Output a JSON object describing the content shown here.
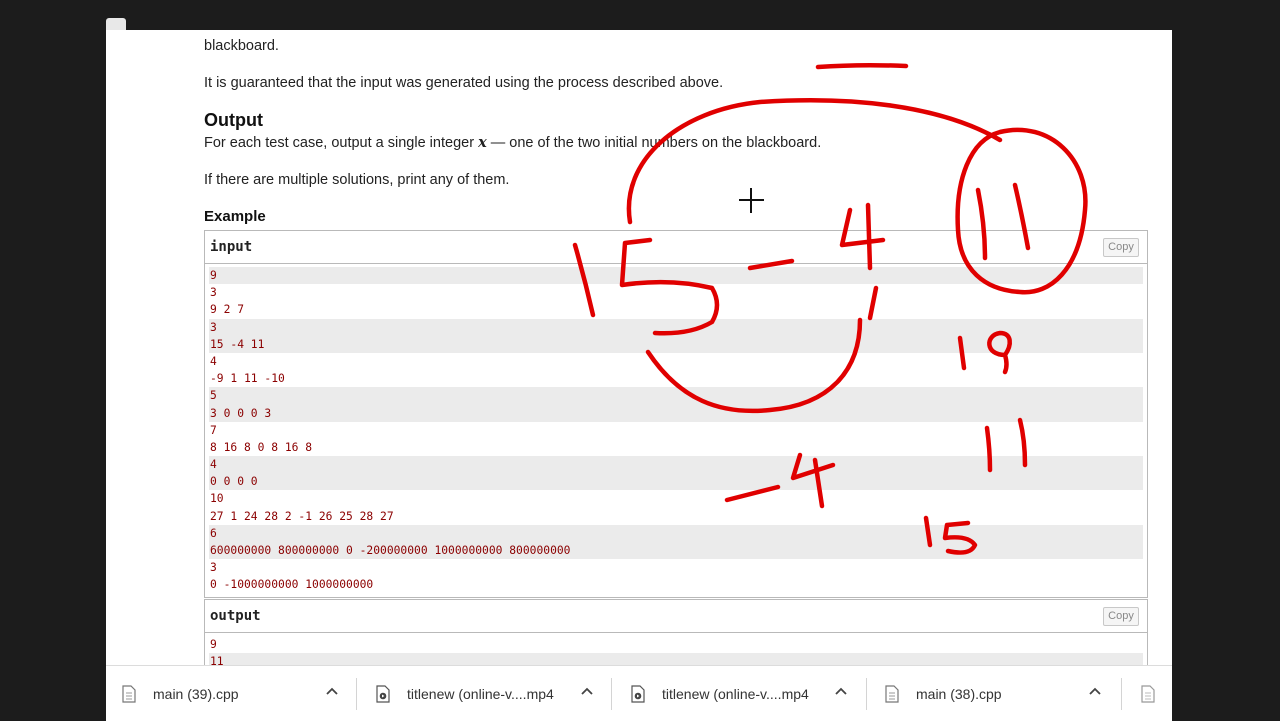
{
  "problem": {
    "cut_text": "blackboard.",
    "guarantee": "It is guaranteed that the input was generated using the process described above.",
    "output_heading": "Output",
    "output_desc_pre": "For each test case, output a single integer",
    "output_var": "x",
    "output_desc_post": "— one of the two initial numbers on the blackboard.",
    "multiple": "If there are multiple solutions, print any of them.",
    "example_heading": "Example"
  },
  "input_box": {
    "title": "input",
    "copy_label": "Copy",
    "lines": [
      "9",
      "3",
      "9 2 7",
      "3",
      "15 -4 11",
      "4",
      "-9 1 11 -10",
      "5",
      "3 0 0 0 3",
      "7",
      "8 16 8 0 8 16 8",
      "4",
      "0 0 0 0",
      "10",
      "27 1 24 28 2 -1 26 25 28 27",
      "6",
      "600000000 800000000 0 -200000000 1000000000 800000000",
      "3",
      "0 -1000000000 1000000000"
    ]
  },
  "output_box": {
    "title": "output",
    "copy_label": "Copy",
    "lines": [
      "9",
      "11"
    ]
  },
  "downloads": [
    {
      "name": "main (39).cpp",
      "type": "cpp"
    },
    {
      "name": "titlenew (online-v....mp4",
      "type": "video"
    },
    {
      "name": "titlenew (online-v....mp4",
      "type": "video"
    },
    {
      "name": "main (38).cpp",
      "type": "cpp"
    }
  ],
  "annotations": {
    "ink_color": "#e00000",
    "marks": [
      "15",
      "-",
      "4",
      "11",
      "19",
      "11",
      "-4",
      "15"
    ]
  }
}
